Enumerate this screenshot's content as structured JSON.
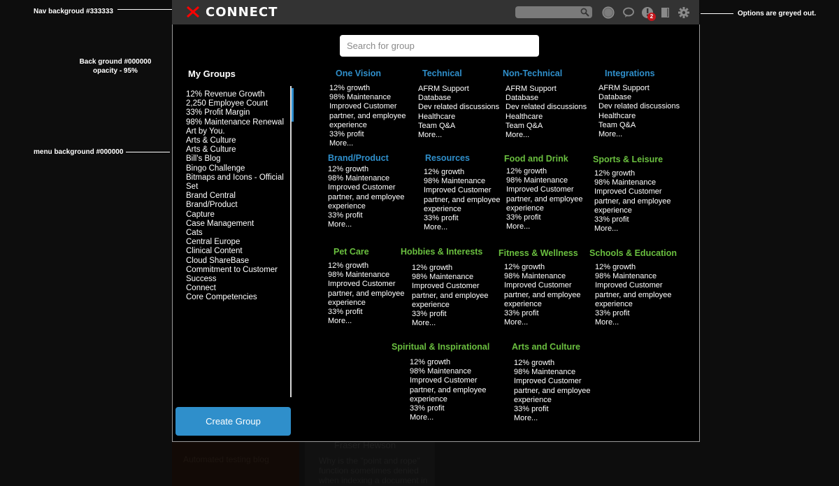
{
  "annotations": {
    "nav_background": "Nav backgroud #333333",
    "background": "Back ground #000000",
    "background_opacity": "opacity - 95%",
    "menu_background": "menu background #000000",
    "options": "Options are greyed out."
  },
  "nav": {
    "logo_text": "CONNECT",
    "search_value": "",
    "notification_count": "2",
    "icons": [
      "avatar-icon",
      "chat-icon",
      "notifications-icon",
      "book-icon",
      "gear-icon"
    ],
    "colors": {
      "background": "#333333",
      "logo_x": "#ff0000",
      "badge": "#c4161c"
    }
  },
  "modal": {
    "search_placeholder": "Search for group",
    "my_groups_title": "My Groups",
    "my_groups": [
      "12% Revenue Growth",
      "2,250 Employee Count",
      "33% Profit Margin",
      "98% Maintenance Renewal",
      "Art by You.",
      "Arts & Culture",
      "Arts & Culture",
      "Bill's Blog",
      "Bingo Challenge",
      "Bitmaps and Icons - Official Set",
      "Brand Central",
      "Brand/Product",
      "Capture",
      "Case Management",
      "Cats",
      "Central Europe",
      "Clinical Content",
      "Cloud ShareBase",
      "Commitment to Customer Success",
      "Connect",
      "Core Competencies"
    ],
    "create_group_label": "Create Group",
    "more_label": "More...",
    "colors": {
      "blue_title": "#2f8fcb",
      "green_title": "#6abf3f",
      "more_link": "#ff6b12",
      "button": "#2f8fcb"
    },
    "categories": [
      {
        "title": "One Vision",
        "color": "blue",
        "lines": [
          "12% growth",
          "98% Maintenance",
          "Improved Customer",
          "partner, and employee",
          "experience",
          "33% profit"
        ]
      },
      {
        "title": "Technical",
        "color": "blue",
        "lines": [
          "AFRM Support",
          "Database",
          "Dev related discussions",
          "Healthcare",
          "Team Q&A"
        ]
      },
      {
        "title": "Non-Technical",
        "color": "blue",
        "lines": [
          "AFRM Support",
          "Database",
          "Dev related discussions",
          "Healthcare",
          "Team Q&A"
        ]
      },
      {
        "title": "Integrations",
        "color": "blue",
        "lines": [
          "AFRM Support",
          "Database",
          "Dev related discussions",
          "Healthcare",
          "Team Q&A"
        ]
      },
      {
        "title": "Brand/Product",
        "color": "blue",
        "lines": [
          "12% growth",
          "98% Maintenance",
          "Improved Customer",
          "partner, and employee",
          "experience",
          "33% profit"
        ]
      },
      {
        "title": "Resources",
        "color": "blue",
        "lines": [
          "12% growth",
          "98% Maintenance",
          "Improved Customer",
          "partner, and employee",
          "experience",
          "33% profit"
        ]
      },
      {
        "title": "Food and Drink",
        "color": "green",
        "lines": [
          "12% growth",
          "98% Maintenance",
          "Improved Customer",
          "partner, and employee",
          "experience",
          "33% profit"
        ]
      },
      {
        "title": "Sports & Leisure",
        "color": "green",
        "lines": [
          "12% growth",
          "98% Maintenance",
          "Improved Customer",
          "partner, and employee",
          "experience",
          "33% profit"
        ]
      },
      {
        "title": "Pet Care",
        "color": "green",
        "lines": [
          "12% growth",
          "98% Maintenance",
          "Improved Customer",
          "partner, and employee",
          "experience",
          "33% profit"
        ]
      },
      {
        "title": "Hobbies & Interests",
        "color": "green",
        "lines": [
          "12% growth",
          "98% Maintenance",
          "Improved Customer",
          "partner, and employee",
          "experience",
          "33% profit"
        ]
      },
      {
        "title": "Fitness & Wellness",
        "color": "green",
        "lines": [
          "12% growth",
          "98% Maintenance",
          "Improved Customer",
          "partner, and employee",
          "experience",
          "33% profit"
        ]
      },
      {
        "title": "Schools & Education",
        "color": "green",
        "lines": [
          "12% growth",
          "98% Maintenance",
          "Improved Customer",
          "partner, and employee",
          "experience",
          "33% profit"
        ]
      },
      {
        "title": "Spiritual & Inspirational",
        "color": "green",
        "lines": [
          "12% growth",
          "98% Maintenance",
          "Improved Customer",
          "partner, and employee",
          "experience",
          "33% profit"
        ]
      },
      {
        "title": "Arts and Culture",
        "color": "green",
        "lines": [
          "12% growth",
          "98% Maintenance",
          "Improved Customer",
          "partner, and employee",
          "experience",
          "33% profit"
        ]
      }
    ]
  },
  "background_page": {
    "heading": "Fraser Hewson",
    "link": "Automated testing blog",
    "body": "Why is the \"point and rope\" function sometimes denied when indexing a document in"
  }
}
